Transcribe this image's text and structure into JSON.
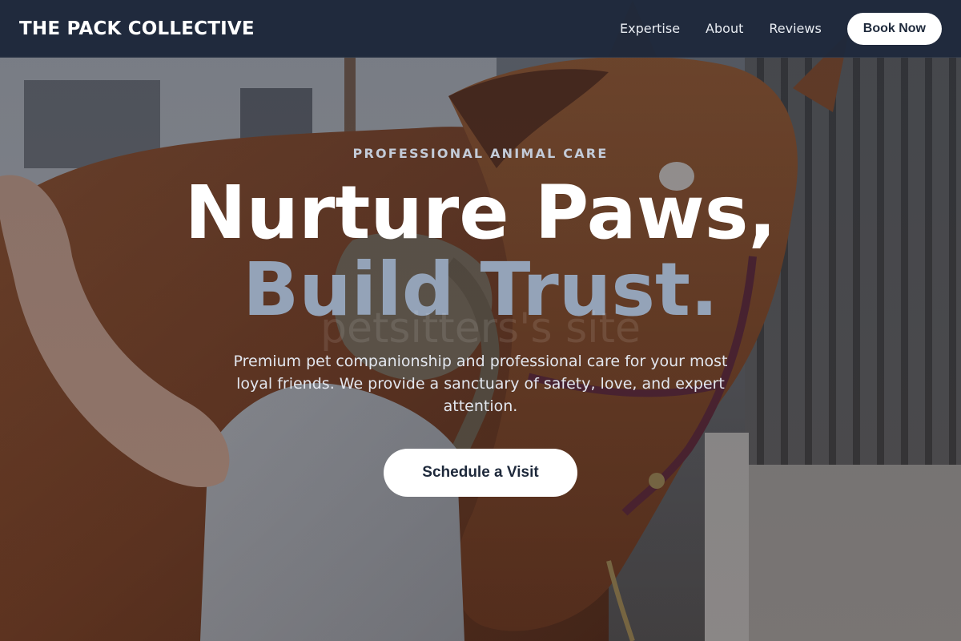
{
  "nav": {
    "brand": "THE PACK COLLECTIVE",
    "links": [
      {
        "label": "Expertise"
      },
      {
        "label": "About"
      },
      {
        "label": "Reviews"
      }
    ],
    "cta_label": "Book Now"
  },
  "hero": {
    "eyebrow": "PROFESSIONAL ANIMAL CARE",
    "headline_line1": "Nurture Paws,",
    "headline_line2": "Build Trust.",
    "watermark": "petsitters's site",
    "subtitle": "Premium pet companionship and professional care for your most loyal friends. We provide a sanctuary of safety, love, and expert attention.",
    "cta_label": "Schedule a Visit"
  },
  "colors": {
    "navbar_bg": "#1e293b",
    "accent_slate": "#94a3b8",
    "button_bg": "#ffffff",
    "button_text": "#1e293b"
  }
}
